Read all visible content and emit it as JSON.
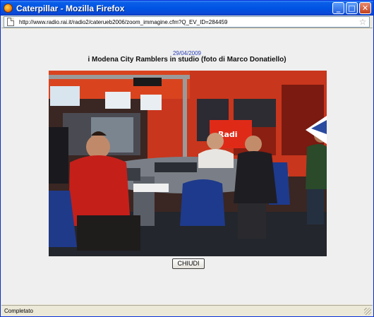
{
  "window": {
    "title": "Caterpillar - Mozilla Firefox",
    "minimize_glyph": "_",
    "maximize_glyph": "□",
    "close_glyph": "✕"
  },
  "address_bar": {
    "url": "http://www.radio.rai.it/radio2/caterueb2006/zoom_immagine.cfm?Q_EV_ID=284459",
    "star_glyph": "☆"
  },
  "content": {
    "date": "29/04/2009",
    "caption": "i Modena City Ramblers in studio (foto di Marco Donatiello)",
    "close_button_label": "CHIUDI"
  },
  "photo": {
    "description_icon": "photo-image"
  },
  "status_bar": {
    "text": "Completato"
  },
  "colors": {
    "titlebar": "#0054e3",
    "page_background": "#efefef",
    "date_color": "#2a3fb5"
  }
}
